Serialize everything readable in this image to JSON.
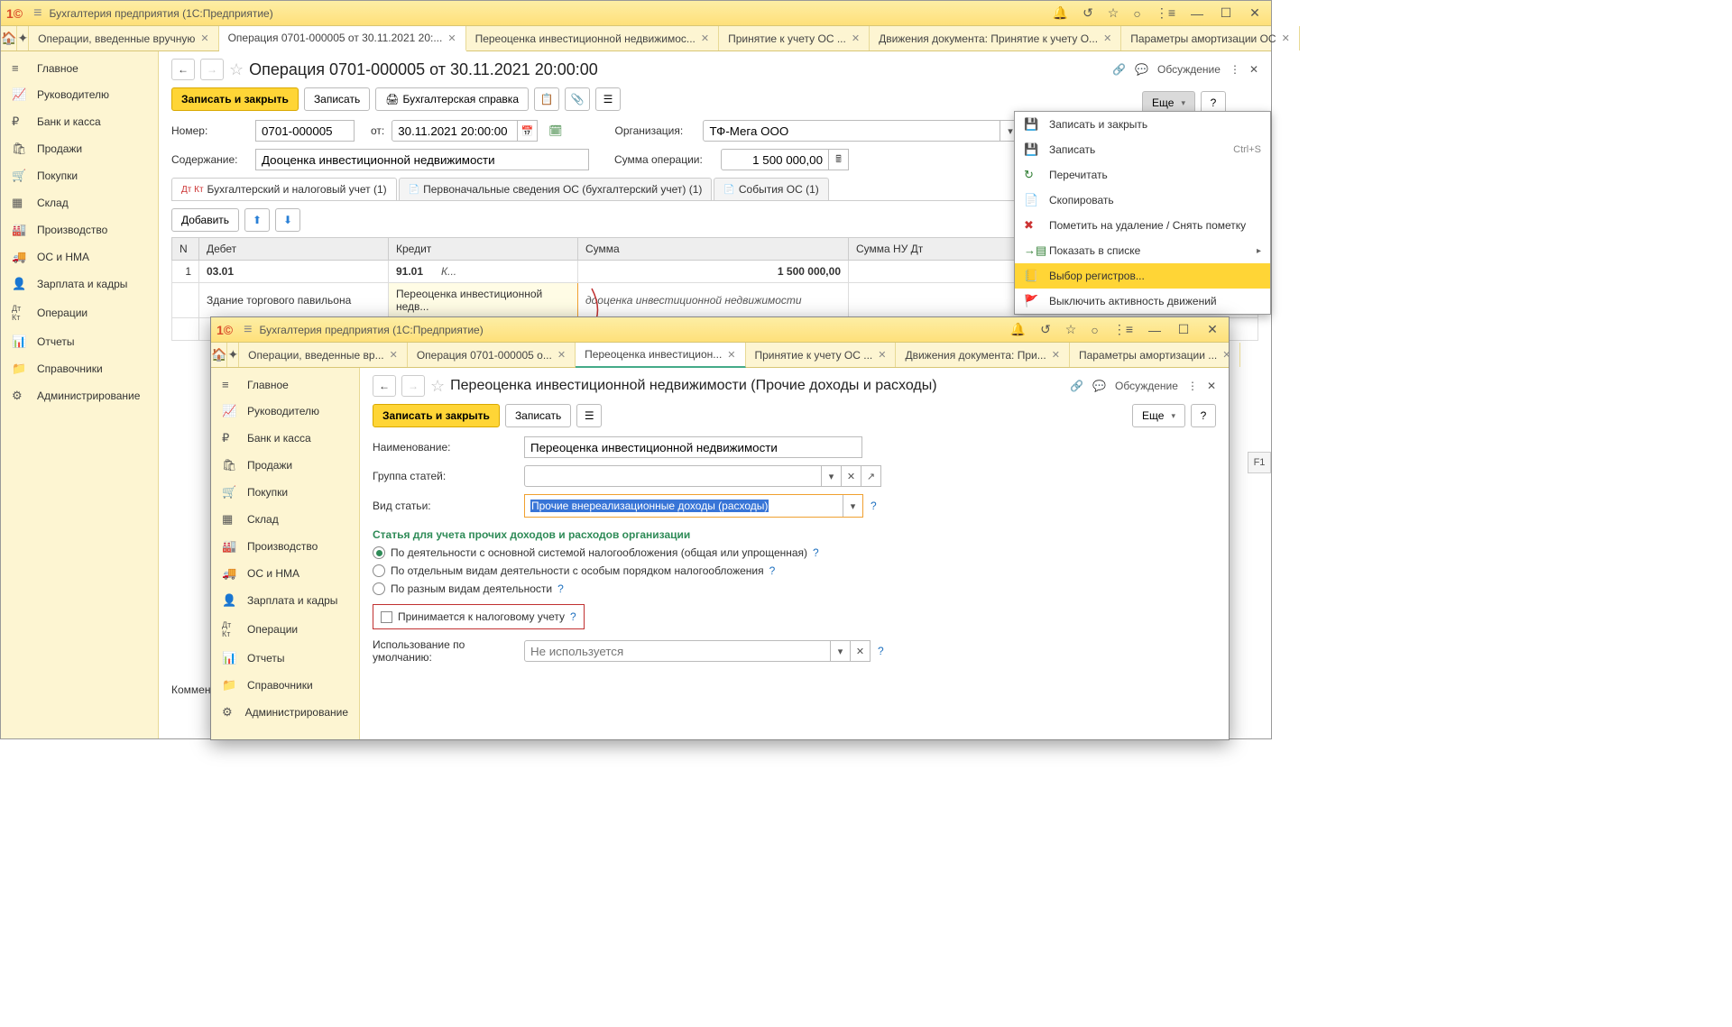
{
  "app_title": "Бухгалтерия предприятия  (1С:Предприятие)",
  "tabs": {
    "t1": "Операции, введенные вручную",
    "t2": "Операция 0701-000005 от 30.11.2021 20:...",
    "t3": "Переоценка инвестиционной недвижимос...",
    "t4": "Принятие к учету ОС ...",
    "t5": "Движения документа: Принятие к учету О...",
    "t6": "Параметры амортизации ОС"
  },
  "sidebar": {
    "main": "Главное",
    "manager": "Руководителю",
    "bank": "Банк и касса",
    "sales": "Продажи",
    "purchases": "Покупки",
    "warehouse": "Склад",
    "production": "Производство",
    "os": "ОС и НМА",
    "salary": "Зарплата и кадры",
    "operations": "Операции",
    "reports": "Отчеты",
    "catalogs": "Справочники",
    "admin": "Администрирование"
  },
  "doc": {
    "title": "Операция 0701-000005 от 30.11.2021 20:00:00",
    "discuss": "Обсуждение",
    "save_close": "Записать и закрыть",
    "save": "Записать",
    "print": "Бухгалтерская справка",
    "more": "Еще",
    "number_label": "Номер:",
    "number": "0701-000005",
    "from_label": "от:",
    "date": "30.11.2021 20:00:00",
    "org_label": "Организация:",
    "org": "ТФ-Мега ООО",
    "content_label": "Содержание:",
    "content": "Дооценка инвестиционной недвижимости",
    "sum_label": "Сумма операции:",
    "sum": "1 500 000,00",
    "comment_label": "Коммент"
  },
  "subtabs": {
    "t1": "Бухгалтерский и налоговый учет (1)",
    "t2": "Первоначальные сведения ОС (бухгалтерский учет) (1)",
    "t3": "События ОС (1)"
  },
  "table": {
    "add": "Добавить",
    "n": "N",
    "debit": "Дебет",
    "credit": "Кредит",
    "sum": "Сумма",
    "sum_nu": "Сумма НУ Дт",
    "row": {
      "n": "1",
      "debit_acc": "03.01",
      "credit_acc": "91.01",
      "credit_k": "К...",
      "sum": "1 500 000,00",
      "debit_obj": "Здание торгового павильона",
      "credit_obj": "Переоценка инвестиционной недв...",
      "comment": "дооценка инвестиционной недвижимости",
      "sub": "<...>"
    }
  },
  "menu": {
    "m1": "Записать и закрыть",
    "m2": "Записать",
    "m2s": "Ctrl+S",
    "m3": "Перечитать",
    "m4": "Скопировать",
    "m5": "Пометить на удаление / Снять пометку",
    "m6": "Показать в списке",
    "m7": "Выбор регистров...",
    "m8": "Выключить активность движений"
  },
  "popup": {
    "app_title": "Бухгалтерия предприятия  (1С:Предприятие)",
    "tabs": {
      "t1": "Операции, введенные вр...",
      "t2": "Операция 0701-000005 о...",
      "t3": "Переоценка инвестицион...",
      "t4": "Принятие к учету ОС ...",
      "t5": "Движения документа: При...",
      "t6": "Параметры амортизации ..."
    },
    "title": "Переоценка инвестиционной недвижимости (Прочие доходы и расходы)",
    "discuss": "Обсуждение",
    "save_close": "Записать и закрыть",
    "save": "Записать",
    "more": "Еще",
    "name_label": "Наименование:",
    "name": "Переоценка инвестиционной недвижимости",
    "group_label": "Группа статей:",
    "kind_label": "Вид статьи:",
    "kind": "Прочие внереализационные доходы (расходы)",
    "section": "Статья для учета прочих доходов и расходов организации",
    "r1": "По деятельности с основной системой налогообложения (общая или упрощенная)",
    "r2": "По отдельным видам деятельности с особым порядком налогообложения",
    "r3": "По разным видам деятельности",
    "cb": "Принимается к налоговому учету",
    "default_label": "Использование по умолчанию:",
    "default_ph": "Не используется"
  },
  "f1": "F1"
}
